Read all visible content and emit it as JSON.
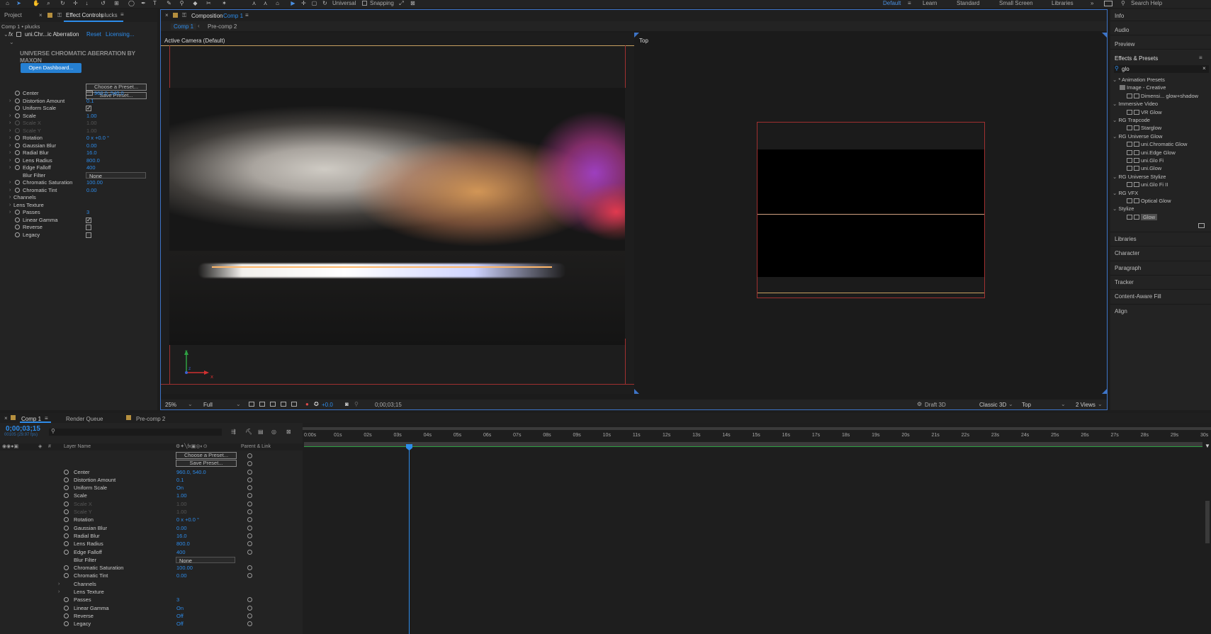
{
  "toolbar": {
    "universal_label": "Universal",
    "snapping_label": "Snapping",
    "workspaces": [
      "Default",
      "Learn",
      "Standard",
      "Small Screen",
      "Libraries"
    ],
    "search_help": "Search Help"
  },
  "left_panel": {
    "tabs": [
      "Project",
      "Effect Controls",
      "plucks"
    ],
    "breadcrumb": "Comp 1 • plucks",
    "effect_name": "uni.Chr...ic Aberration",
    "reset": "Reset",
    "licensing": "Licensing...",
    "plugin_title": "UNIVERSE CHROMATIC ABERRATION BY MAXON",
    "open_dashboard": "Open Dashboard...",
    "choose_preset": "Choose a Preset...",
    "save_preset": "Save Preset...",
    "params": [
      {
        "label": "Center",
        "value": "960.0, 540.0"
      },
      {
        "label": "Distortion Amount",
        "value": "0.1"
      },
      {
        "label": "Uniform Scale",
        "value": ""
      },
      {
        "label": "Scale",
        "value": "1.00"
      },
      {
        "label": "Scale X",
        "value": "1.00"
      },
      {
        "label": "Scale Y",
        "value": "1.00"
      },
      {
        "label": "Rotation",
        "value": "0 x +0.0 °"
      },
      {
        "label": "Gaussian Blur",
        "value": "0.00"
      },
      {
        "label": "Radial Blur",
        "value": "16.0"
      },
      {
        "label": "Lens Radius",
        "value": "800.0"
      },
      {
        "label": "Edge Falloff",
        "value": "400"
      },
      {
        "label": "Blur Filter",
        "value": "None"
      },
      {
        "label": "Chromatic Saturation",
        "value": "100.00"
      },
      {
        "label": "Chromatic Tint",
        "value": "0.00"
      },
      {
        "label": "Channels",
        "value": ""
      },
      {
        "label": "Lens Texture",
        "value": ""
      },
      {
        "label": "Passes",
        "value": "3"
      },
      {
        "label": "Linear Gamma",
        "value": ""
      },
      {
        "label": "Reverse",
        "value": ""
      },
      {
        "label": "Legacy",
        "value": ""
      }
    ]
  },
  "viewer": {
    "panel_label": "Composition",
    "comp_name": "Comp 1",
    "tabs": [
      "Comp 1",
      "Pre-comp 2"
    ],
    "active_camera": "Active Camera (Default)",
    "top_label": "Top",
    "zoom": "25%",
    "resolution": "Full",
    "exposure": "+0.0",
    "timecode": "0;00;03;15",
    "renderer_label": "Draft 3D",
    "renderer": "Classic 3D",
    "view": "Top",
    "views": "2 Views"
  },
  "right_panel": {
    "sections_top": [
      "Info",
      "Audio",
      "Preview",
      "Effects & Presets"
    ],
    "search_value": "glo",
    "tree": [
      {
        "label": "* Animation Presets",
        "kind": "folder",
        "indent": 0
      },
      {
        "label": "Image - Creative",
        "kind": "subfolder",
        "indent": 1
      },
      {
        "label": "Dimensi... glow+shadow",
        "kind": "item",
        "indent": 2
      },
      {
        "label": "Immersive Video",
        "kind": "folder",
        "indent": 0
      },
      {
        "label": "VR Glow",
        "kind": "item",
        "indent": 2
      },
      {
        "label": "RG Trapcode",
        "kind": "folder",
        "indent": 0
      },
      {
        "label": "Starglow",
        "kind": "item",
        "indent": 2
      },
      {
        "label": "RG Universe Glow",
        "kind": "folder",
        "indent": 0
      },
      {
        "label": "uni.Chromatic Glow",
        "kind": "item",
        "indent": 2
      },
      {
        "label": "uni.Edge Glow",
        "kind": "item",
        "indent": 2
      },
      {
        "label": "uni.Glo Fi",
        "kind": "item",
        "indent": 2
      },
      {
        "label": "uni.Glow",
        "kind": "item",
        "indent": 2
      },
      {
        "label": "RG Universe Stylize",
        "kind": "folder",
        "indent": 0
      },
      {
        "label": "uni.Glo Fi II",
        "kind": "item",
        "indent": 2
      },
      {
        "label": "RG VFX",
        "kind": "folder",
        "indent": 0
      },
      {
        "label": "Optical Glow",
        "kind": "item",
        "indent": 2
      },
      {
        "label": "Stylize",
        "kind": "folder",
        "indent": 0
      },
      {
        "label": "Glow",
        "kind": "item",
        "indent": 2
      }
    ],
    "sections_bottom": [
      "Libraries",
      "Character",
      "Paragraph",
      "Tracker",
      "Content-Aware Fill",
      "Align"
    ]
  },
  "timeline": {
    "tabs": [
      "Comp 1",
      "Render Queue",
      "Pre-comp 2"
    ],
    "timecode": "0;00;03;15",
    "frame_info": "00105 (29.97 fps)",
    "col_layer_name": "Layer Name",
    "col_parent": "Parent & Link",
    "ruler": [
      "0:00s",
      "01s",
      "02s",
      "03s",
      "04s",
      "05s",
      "06s",
      "07s",
      "08s",
      "09s",
      "10s",
      "11s",
      "12s",
      "13s",
      "14s",
      "15s",
      "16s",
      "17s",
      "18s",
      "19s",
      "20s",
      "21s",
      "22s",
      "23s",
      "24s",
      "25s",
      "26s",
      "27s",
      "28s",
      "29s",
      "30s"
    ],
    "choose_preset": "Choose a Preset...",
    "save_preset": "Save Preset...",
    "params": [
      {
        "label": "Center",
        "value": "960.0, 540.0"
      },
      {
        "label": "Distortion Amount",
        "value": "0.1"
      },
      {
        "label": "Uniform Scale",
        "value": "On"
      },
      {
        "label": "Scale",
        "value": "1.00"
      },
      {
        "label": "Scale X",
        "value": "1.00"
      },
      {
        "label": "Scale Y",
        "value": "1.00"
      },
      {
        "label": "Rotation",
        "value": "0 x +0.0 °"
      },
      {
        "label": "Gaussian Blur",
        "value": "0.00"
      },
      {
        "label": "Radial Blur",
        "value": "16.0"
      },
      {
        "label": "Lens Radius",
        "value": "800.0"
      },
      {
        "label": "Edge Falloff",
        "value": "400"
      },
      {
        "label": "Blur Filter",
        "value": "None"
      },
      {
        "label": "Chromatic Saturation",
        "value": "100.00"
      },
      {
        "label": "Chromatic Tint",
        "value": "0.00"
      },
      {
        "label": "Channels",
        "value": ""
      },
      {
        "label": "Lens Texture",
        "value": ""
      },
      {
        "label": "Passes",
        "value": "3"
      },
      {
        "label": "Linear Gamma",
        "value": "On"
      },
      {
        "label": "Reverse",
        "value": "Off"
      },
      {
        "label": "Legacy",
        "value": "Off"
      }
    ]
  }
}
